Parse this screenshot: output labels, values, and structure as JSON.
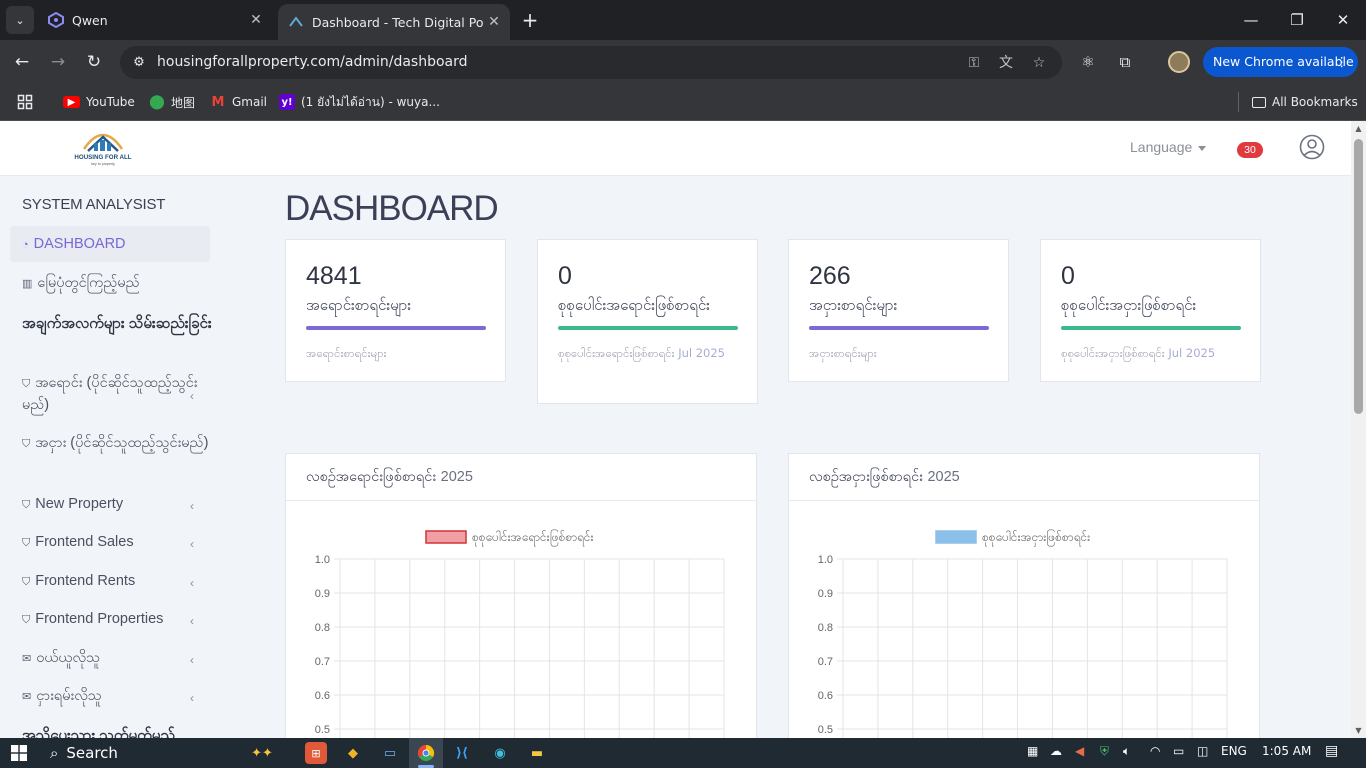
{
  "browser": {
    "tabs": [
      {
        "title": "Qwen",
        "active": false
      },
      {
        "title": "Dashboard - Tech Digital Pocket",
        "active": true
      }
    ],
    "url": "housingforallproperty.com/admin/dashboard",
    "update_chip": "New Chrome available",
    "bookmarks": [
      {
        "label": "YouTube",
        "icon": "youtube-icon"
      },
      {
        "label": "地图",
        "icon": "maps-icon"
      },
      {
        "label": "Gmail",
        "icon": "gmail-icon"
      },
      {
        "label": "(1 ยังไม่ได้อ่าน) - wuya...",
        "icon": "yahoo-icon"
      }
    ],
    "all_bookmarks": "All Bookmarks"
  },
  "header": {
    "logo_text": "HOUSING FOR ALL",
    "logo_tagline": "key to property",
    "language": "Language",
    "notification_count": "30"
  },
  "sidebar": {
    "title": "SYSTEM ANALYSIST",
    "items": [
      {
        "label": "DASHBOARD",
        "active": true
      },
      {
        "label": "မြေပုံတွင်ကြည့်မည်"
      },
      {
        "heading": "အချက်အလက်များ သိမ်းဆည်းခြင်း"
      },
      {
        "label": "အရောင်း (ပိုင်ဆိုင်သူထည့်သွင်းမည်)",
        "chevron": true
      },
      {
        "label": "အငှား (ပိုင်ဆိုင်သူထည့်သွင်းမည်)"
      },
      {
        "label": "New Property",
        "chevron": true
      },
      {
        "label": "Frontend Sales",
        "chevron": true
      },
      {
        "label": "Frontend Rents",
        "chevron": true
      },
      {
        "label": "Frontend Properties",
        "chevron": true
      },
      {
        "label": "ဝယ်ယူလိုသူ",
        "chevron": true
      },
      {
        "label": "ငှားရမ်းလိုသူ",
        "chevron": true
      },
      {
        "heading": "အသိပေးသား သတ်မှတ်မည်"
      }
    ]
  },
  "main": {
    "title": "DASHBOARD",
    "cards": [
      {
        "value": "4841",
        "label": "အရောင်းစာရင်းများ",
        "sub": "အရောင်းစာရင်းများ",
        "date": "",
        "color": "#7b6ad6"
      },
      {
        "value": "0",
        "label": "စုစုပေါင်းအရောင်းဖြစ်စာရင်း",
        "sub": "စုစုပေါင်းအရောင်းဖြစ်စာရင်း",
        "date": "Jul 2025",
        "color": "#3db88a"
      },
      {
        "value": "266",
        "label": "အငှားစာရင်းများ",
        "sub": "အငှားစာရင်းများ",
        "date": "",
        "color": "#7b6ad6"
      },
      {
        "value": "0",
        "label": "စုစုပေါင်းအငှားဖြစ်စာရင်း",
        "sub": "စုစုပေါင်းအငှားဖြစ်စာရင်း",
        "date": "Jul 2025",
        "color": "#3db88a"
      }
    ],
    "charts_header": [
      {
        "title": "လစဉ်အရောင်းဖြစ်စာရင်း",
        "year": "2025"
      },
      {
        "title": "လစဉ်အငှားဖြစ်စာရင်း",
        "year": "2025"
      }
    ]
  },
  "chart_data": [
    {
      "type": "bar",
      "title": "လစဉ်အရောင်းဖြစ်စာရင်း 2025",
      "series": [
        {
          "name": "စုစုပေါင်းအရောင်းဖြစ်စာရင်း",
          "values": [],
          "color": "#f0a0a4",
          "border": "#d0343c"
        }
      ],
      "ylim": [
        0,
        1.0
      ],
      "yticks": [
        "1.0",
        "0.9",
        "0.8",
        "0.7",
        "0.6",
        "0.5"
      ],
      "grid": true,
      "legend": "top"
    },
    {
      "type": "bar",
      "title": "လစဉ်အငှားဖြစ်စာရင်း 2025",
      "series": [
        {
          "name": "စုစုပေါင်းအငှားဖြစ်စာရင်း",
          "values": [],
          "color": "#8cc0ea",
          "border": "#8cc0ea"
        }
      ],
      "ylim": [
        0,
        1.0
      ],
      "yticks": [
        "1.0",
        "0.9",
        "0.8",
        "0.7",
        "0.6",
        "0.5"
      ],
      "grid": true,
      "legend": "top"
    }
  ],
  "taskbar": {
    "search": "Search",
    "lang": "ENG",
    "time": "1:05 AM"
  }
}
